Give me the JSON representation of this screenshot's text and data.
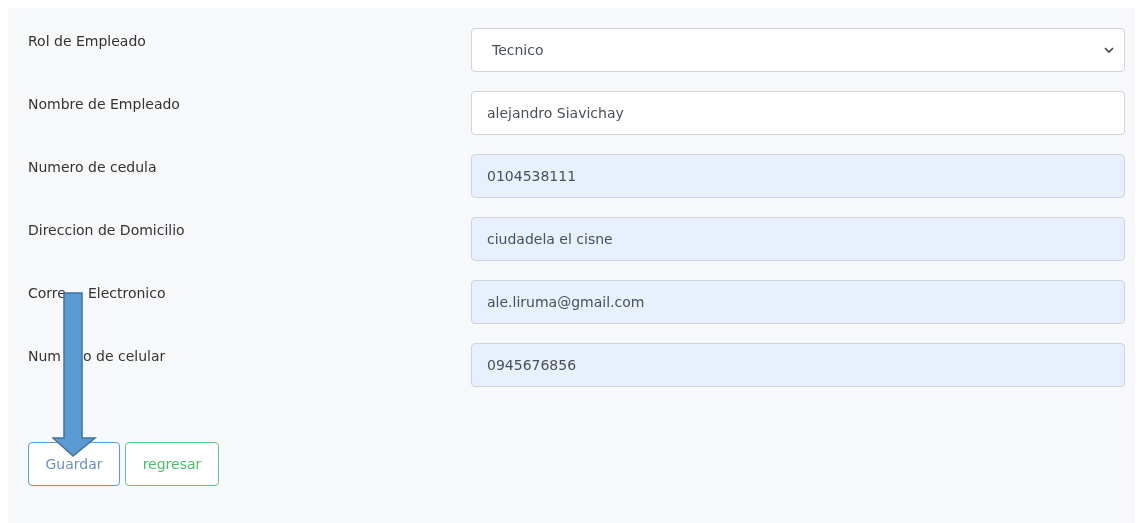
{
  "fields": [
    {
      "label": [
        "Rol de Empleado"
      ],
      "kind": "select",
      "value": "Tecnico",
      "autofilled": false
    },
    {
      "label": [
        "Nombre de Empleado"
      ],
      "kind": "text",
      "value": "alejandro Siavichay",
      "autofilled": false
    },
    {
      "label": [
        "Numero de cedula"
      ],
      "kind": "text",
      "value": "0104538111",
      "autofilled": true
    },
    {
      "label": [
        "Direccion de Domicilio"
      ],
      "kind": "text",
      "value": "ciudadela el cisne",
      "autofilled": true
    },
    {
      "label": [
        "Corre",
        "Electronico"
      ],
      "kind": "text",
      "value": "ale.liruma@gmail.com",
      "autofilled": true
    },
    {
      "label": [
        "Num",
        "o de celular"
      ],
      "kind": "text",
      "value": "0945676856",
      "autofilled": true
    }
  ],
  "buttons": [
    {
      "label": "Guardar",
      "kind": "primary"
    },
    {
      "label": "regresar",
      "kind": "success"
    }
  ]
}
